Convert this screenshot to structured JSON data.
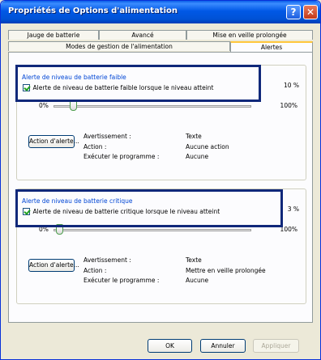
{
  "window": {
    "title": "Propriétés de Options d'alimentation",
    "help_glyph": "?",
    "close_glyph": "✕"
  },
  "tabs": {
    "row1": [
      "Jauge de batterie",
      "Avancé",
      "Mise en veille prolongée"
    ],
    "row2": [
      "Modes de gestion de l'alimentation",
      "Alertes"
    ],
    "active": "Alertes"
  },
  "low_battery": {
    "group_title": "Alerte de niveau de batterie faible",
    "checkbox_label": "Alerte de niveau de batterie faible lorsque le niveau atteint",
    "checked": true,
    "level": "10 %",
    "slider_min": "0%",
    "slider_max": "100%",
    "slider_value": 0.1,
    "action_button": "Action d'alerte...",
    "notification_key": "Avertissement :",
    "notification_value": "Texte",
    "action_key": "Action :",
    "action_value": "Aucune action",
    "program_key": "Exécuter le programme :",
    "program_value": "Aucune"
  },
  "critical_battery": {
    "group_title": "Alerte de niveau de batterie critique",
    "checkbox_label": "Alerte de niveau de batterie critique lorsque le niveau atteint",
    "checked": true,
    "level": "3 %",
    "slider_min": "0%",
    "slider_max": "100%",
    "slider_value": 0.03,
    "action_button": "Action d'alerte...",
    "notification_key": "Avertissement :",
    "notification_value": "Texte",
    "action_key": "Action :",
    "action_value": "Mettre en veille prolongée",
    "program_key": "Exécuter le programme :",
    "program_value": "Aucune"
  },
  "buttons": {
    "ok": "OK",
    "cancel": "Annuler",
    "apply": "Appliquer"
  },
  "colors": {
    "title_bar": "#0054e3",
    "highlight_box": "#10287a",
    "group_title": "#0046d5",
    "checkmark": "#21a121"
  }
}
